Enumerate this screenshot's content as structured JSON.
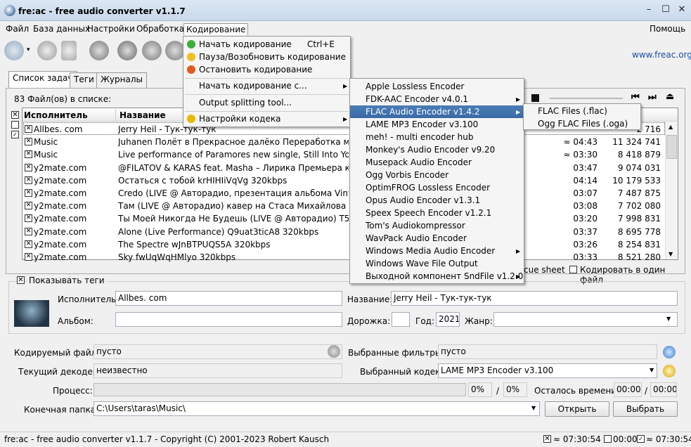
{
  "window": {
    "title": "fre:ac - free audio converter v1.1.7"
  },
  "menubar": {
    "file": "Файл",
    "database": "База данных",
    "settings": "Настройки",
    "processing": "Обработка",
    "encode": "Кодирование",
    "help": "Помощь"
  },
  "toolbar": {
    "link": "www.freac.org"
  },
  "tabs": [
    "Список задач",
    "Теги",
    "Журналы"
  ],
  "list": {
    "count": "83 Файл(ов) в списке:",
    "col_artist": "Исполнитель",
    "col_title": "Название",
    "rows": [
      {
        "artist": "Allbes. com",
        "title": "Jerry Heil - Тук-тук-тук",
        "time": "",
        "size": "2 716"
      },
      {
        "artist": "Music",
        "title": "Juhanen Полёт в Прекрасное далёко Переработка музыки Е",
        "time": "≈ 04:43",
        "size": "11 324 741"
      },
      {
        "artist": "Music",
        "title": "Live performance of Paramores new single, Still Into You GRAM",
        "time": "≈ 03:30",
        "size": "8 418 879"
      },
      {
        "artist": "y2mate.com",
        "title": "@FILATOV & KARAS feat. Masha – Лирика   Премьера клипа",
        "time": "03:47",
        "size": "9 074 031"
      },
      {
        "artist": "y2mate.com",
        "title": "Остаться с тобой krHIHIiVqVg 320kbps",
        "time": "04:14",
        "size": "10 179 533"
      },
      {
        "artist": "y2mate.com",
        "title": "Credo (LIVE @ Авторадио, презентация альбома Vinyl #1) Jk-",
        "time": "03:07",
        "size": "7 487 875"
      },
      {
        "artist": "y2mate.com",
        "title": "Там (LIVE @ Авторадио) кавер на Стаса Михайлова -CrbU-g",
        "time": "03:08",
        "size": "7 702 080"
      },
      {
        "artist": "y2mate.com",
        "title": "Ты Моей Никогда Не Будешь (LIVE @ Авторадио) T5XKpkBe",
        "time": "03:20",
        "size": "7 998 831"
      },
      {
        "artist": "y2mate.com",
        "title": "Alone (Live Performance) Q9uat3ticA8 320kbps",
        "time": "03:37",
        "size": "8 695 778"
      },
      {
        "artist": "y2mate.com",
        "title": "The Spectre wJnBTPUQS5A 320kbps",
        "time": "03:26",
        "size": "8 254 831"
      },
      {
        "artist": "y2mate.com",
        "title": "Sky fwUqWqHMlyo 320kbps",
        "time": "03:33",
        "size": "8 521 280"
      }
    ]
  },
  "options": {
    "cue": "cue sheet",
    "single": "Кодировать в один файл",
    "show_tags": "Показывать теги"
  },
  "tags": {
    "artist_label": "Исполнитель:",
    "artist": "Allbes. com",
    "title_label": "Название:",
    "title": "Jerry Heil - Тук-тук-тук",
    "album_label": "Альбом:",
    "track_label": "Дорожка:",
    "year_label": "Год:",
    "year": "2021",
    "genre_label": "Жанр:"
  },
  "status": {
    "file_label": "Кодируемый файл:",
    "file": "пусто",
    "filters_label": "Выбранные фильтры:",
    "filters": "пусто",
    "decoder_label": "Текущий декодер:",
    "decoder": "неизвестно",
    "codec_label": "Выбранный кодек:",
    "codec": "LAME MP3 Encoder v3.100",
    "progress_label": "Процесс:",
    "p1": "0%",
    "slash": "/",
    "p2": "0%",
    "remaining_label": "Осталось времени:",
    "t1": "00:00",
    "t2": "00:00",
    "folder_label": "Конечная папка:",
    "folder": "C:\\Users\\taras\\Music\\",
    "open": "Открыть",
    "choose": "Выбрать"
  },
  "statusbar": {
    "text": "fre:ac - free audio converter v1.1.7 - Copyright (C) 2001-2023 Robert Kausch",
    "t1": "≈ 07:30:54",
    "t2": "00:00",
    "t3": "≈ 07:30:54"
  },
  "menu_encode": {
    "start": "Начать кодирование",
    "start_key": "Ctrl+E",
    "pause": "Пауза/Возобновить кодирование",
    "stop": "Остановить кодирование",
    "start_with": "Начать кодирование с...",
    "split": "Output splitting tool...",
    "codec_settings": "Настройки кодека"
  },
  "menu_encoders": [
    "Apple Lossless Encoder",
    "FDK-AAC Encoder v4.0.1",
    "FLAC Audio Encoder v1.4.2",
    "LAME MP3 Encoder v3.100",
    "meh! - multi encoder hub",
    "Monkey's Audio Encoder v9.20",
    "Musepack Audio Encoder",
    "Ogg Vorbis Encoder",
    "OptimFROG Lossless Encoder",
    "Opus Audio Encoder v1.3.1",
    "Speex Speech Encoder v1.2.1",
    "Tom's Audiokompressor",
    "WavPack Audio Encoder",
    "Windows Media Audio Encoder",
    "Windows Wave File Output",
    "Выходной компонент SndFile v1.2.0"
  ],
  "menu_flac": [
    "FLAC Files (.flac)",
    "Ogg FLAC Files (.oga)"
  ]
}
